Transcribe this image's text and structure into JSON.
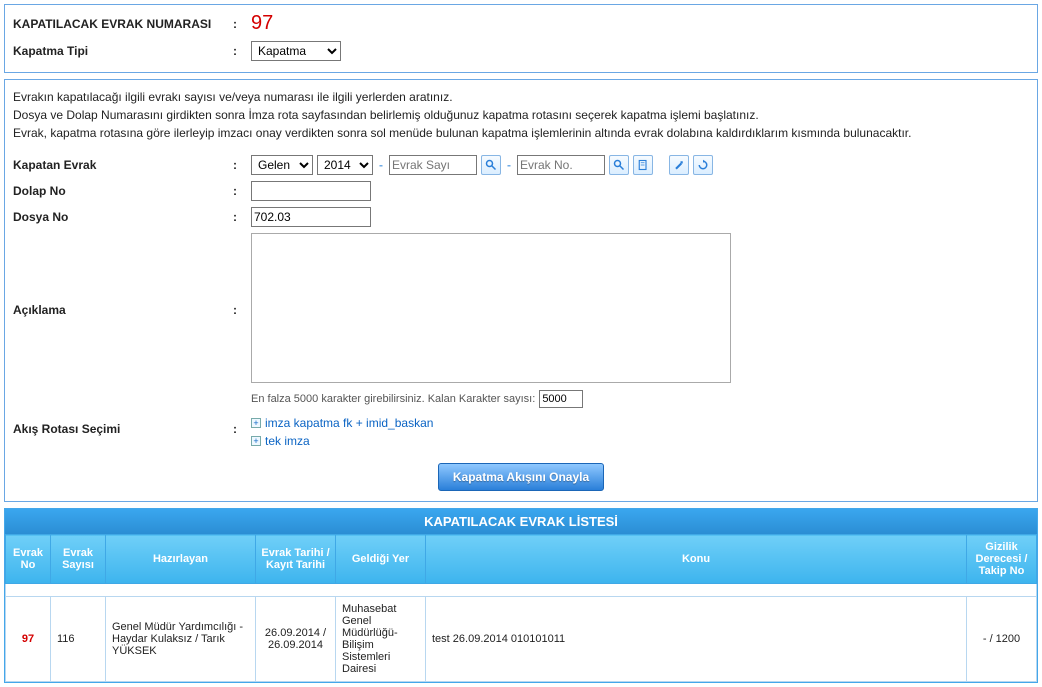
{
  "header": {
    "kapat_label": "KAPATILACAK EVRAK NUMARASI",
    "kapat_value": "97",
    "tip_label": "Kapatma Tipi",
    "tip_value": "Kapatma"
  },
  "instructions": {
    "l1": "Evrakın kapatılacağı ilgili evrakı sayısı ve/veya numarası ile ilgili yerlerden aratınız.",
    "l2": "Dosya ve Dolap Numarasını girdikten sonra İmza rota sayfasından belirlemiş olduğunuz kapatma rotasını seçerek kapatma işlemi başlatınız.",
    "l3": "Evrak, kapatma rotasına göre ilerleyip imzacı onay verdikten sonra sol menüde bulunan kapatma işlemlerinin altında evrak dolabına kaldırdıklarım kısmında bulunacaktır."
  },
  "form": {
    "kapatan_label": "Kapatan Evrak",
    "gelen": "Gelen",
    "yil": "2014",
    "sayi_ph": "Evrak Sayı",
    "no_ph": "Evrak No.",
    "dolap_label": "Dolap No",
    "dolap_value": "",
    "dosya_label": "Dosya No",
    "dosya_value": "702.03",
    "aciklama_label": "Açıklama",
    "aciklama_value": "",
    "charcount_text": "En falza 5000 karakter girebilirsiniz. Kalan Karakter sayısı:",
    "charcount_value": "5000",
    "rota_label": "Akış Rotası Seçimi",
    "rota_items": {
      "a": "imza kapatma fk + imid_baskan",
      "b": "tek imza"
    },
    "submit": "Kapatma Akışını Onayla"
  },
  "table": {
    "title": "KAPATILACAK EVRAK LİSTESİ",
    "headers": {
      "no": "Evrak No",
      "sayi": "Evrak Sayısı",
      "hazirlayan": "Hazırlayan",
      "tarih": "Evrak Tarihi / Kayıt Tarihi",
      "yer": "Geldiği Yer",
      "konu": "Konu",
      "gizlilik": "Gizilik Derecesi / Takip No"
    },
    "row": {
      "no": "97",
      "sayi": "116",
      "hazirlayan": "Genel Müdür Yardımcılığı - Haydar Kulaksız / Tarık YÜKSEK",
      "tarih": "26.09.2014 / 26.09.2014",
      "yer": "Muhasebat Genel Müdürlüğü-Bilişim Sistemleri Dairesi",
      "konu": "test 26.09.2014 010101011",
      "gizlilik": "- / 1200"
    }
  }
}
